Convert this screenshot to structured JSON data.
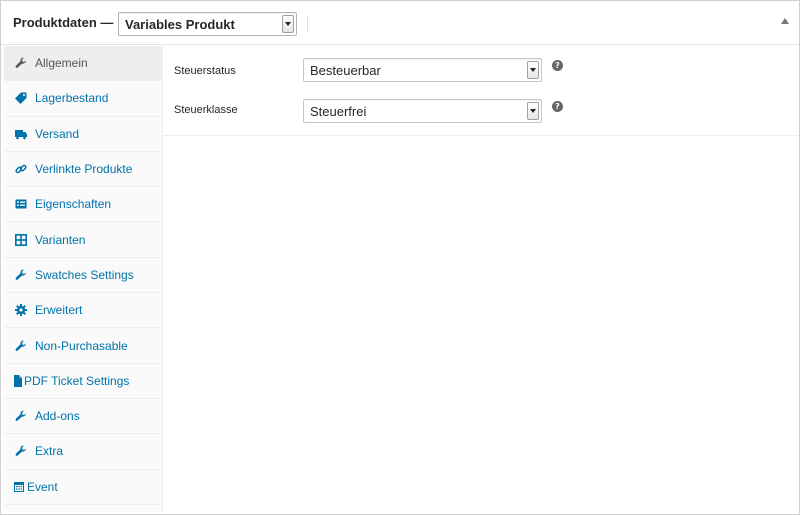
{
  "header": {
    "title": "Produktdaten —",
    "product_type": "Variables Produkt"
  },
  "sidebar": {
    "items": [
      {
        "label": "Allgemein",
        "icon": "wrench-icon",
        "active": true
      },
      {
        "label": "Lagerbestand",
        "icon": "tag-icon",
        "active": false
      },
      {
        "label": "Versand",
        "icon": "truck-icon",
        "active": false
      },
      {
        "label": "Verlinkte Produkte",
        "icon": "link-icon",
        "active": false
      },
      {
        "label": "Eigenschaften",
        "icon": "list-card-icon",
        "active": false
      },
      {
        "label": "Varianten",
        "icon": "grid-icon",
        "active": false
      },
      {
        "label": "Swatches Settings",
        "icon": "wrench-icon",
        "active": false
      },
      {
        "label": "Erweitert",
        "icon": "gear-icon",
        "active": false
      },
      {
        "label": "Non-Purchasable",
        "icon": "wrench-icon",
        "active": false
      },
      {
        "label": "PDF Ticket Settings",
        "icon": "document-icon",
        "active": false
      },
      {
        "label": "Add-ons",
        "icon": "wrench-icon",
        "active": false
      },
      {
        "label": "Extra",
        "icon": "wrench-icon",
        "active": false
      },
      {
        "label": "Event",
        "icon": "calendar-icon",
        "active": false
      }
    ]
  },
  "general": {
    "tax_status_label": "Steuerstatus",
    "tax_status_value": "Besteuerbar",
    "tax_class_label": "Steuerklasse",
    "tax_class_value": "Steuerfrei",
    "help_glyph": "?"
  },
  "colors": {
    "link": "#0073aa",
    "active_tab_bg": "#eeeeee",
    "sidebar_bg": "#fafafa"
  }
}
